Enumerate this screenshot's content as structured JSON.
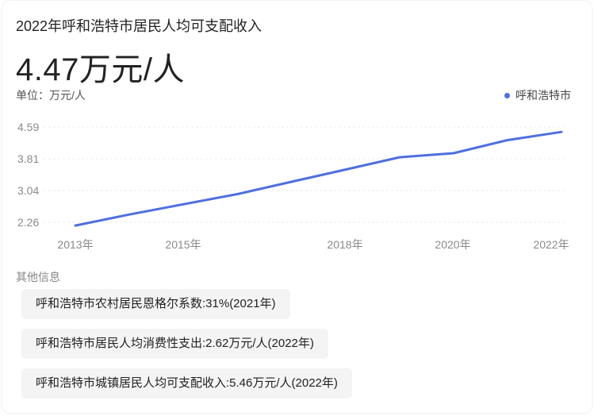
{
  "header": {
    "title": "2022年呼和浩特市居民人均可支配收入",
    "value": "4.47万元/人",
    "unit": "单位：万元/人"
  },
  "colors": {
    "series": "#4e6fe0"
  },
  "chart_data": {
    "type": "line",
    "x": [
      "2013年",
      "2014年",
      "2015年",
      "2016年",
      "2017年",
      "2018年",
      "2019年",
      "2020年",
      "2021年",
      "2022年"
    ],
    "x_tick_labels": [
      "2013年",
      "2015年",
      "2018年",
      "2020年",
      "2022年"
    ],
    "y_tick_labels": [
      "4.59",
      "3.81",
      "3.04",
      "2.26"
    ],
    "y_ticks": [
      4.59,
      3.81,
      3.04,
      2.26
    ],
    "ylim": [
      2.26,
      4.59
    ],
    "series": [
      {
        "name": "呼和浩特市",
        "values": [
          2.18,
          2.45,
          2.7,
          2.95,
          3.25,
          3.55,
          3.85,
          3.95,
          4.27,
          4.47
        ]
      }
    ],
    "legend": "top-right",
    "grid": true
  },
  "other_info": {
    "title": "其他信息",
    "items": [
      "呼和浩特市农村居民恩格尔系数:31%(2021年)",
      "呼和浩特市居民人均消费性支出:2.62万元/人(2022年)",
      "呼和浩特市城镇居民人均可支配收入:5.46万元/人(2022年)"
    ]
  }
}
